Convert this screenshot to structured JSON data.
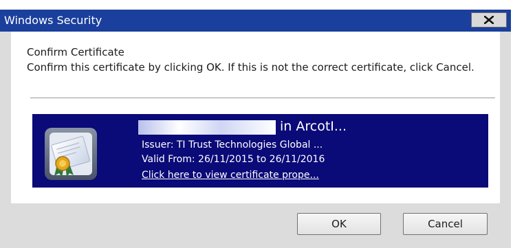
{
  "window": {
    "title": "Windows Security",
    "close_icon": "close-icon"
  },
  "dialog": {
    "heading": "Confirm Certificate",
    "message": "Confirm this certificate by clicking OK. If this is not the correct certificate, click Cancel."
  },
  "certificate": {
    "icon": "certificate-icon",
    "subject_suffix": "in ArcotI...",
    "issuer": "Issuer: TI Trust Technologies Global ...",
    "valid": "Valid From: 26/11/2015 to 26/11/2016",
    "link": "Click here to view certificate prope...",
    "tile_color": "#0a0a78"
  },
  "buttons": {
    "ok": "OK",
    "cancel": "Cancel"
  },
  "colors": {
    "titlebar": "#1a3f9c",
    "dialog_frame": "#dcdcdc"
  }
}
